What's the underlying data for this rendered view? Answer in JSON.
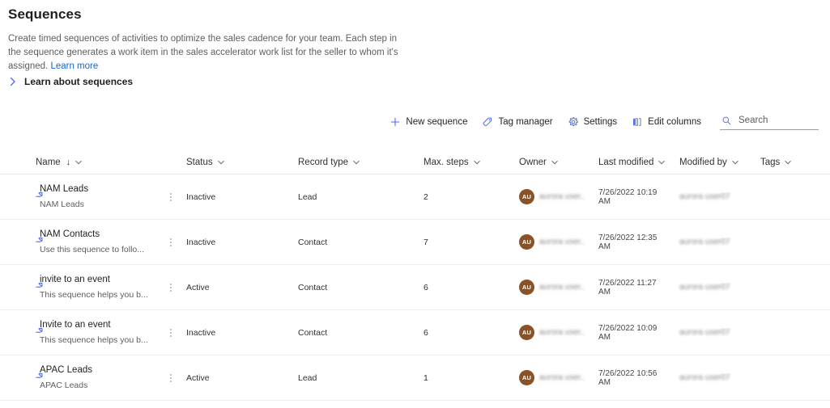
{
  "header": {
    "title": "Sequences",
    "description": "Create timed sequences of activities to optimize the sales cadence for your team. Each step in the sequence generates a work item in the sales accelerator work list for the seller to whom it's assigned.",
    "learn_more": "Learn more",
    "expander_label": "Learn about sequences"
  },
  "commandbar": {
    "new_sequence": "New sequence",
    "tag_manager": "Tag manager",
    "settings": "Settings",
    "edit_columns": "Edit columns",
    "search_placeholder": "Search",
    "search_value": ""
  },
  "grid": {
    "columns": [
      {
        "label": "Name",
        "sorted": true,
        "sort_glyph": "↓"
      },
      {
        "label": "Status"
      },
      {
        "label": "Record type"
      },
      {
        "label": "Max. steps"
      },
      {
        "label": "Owner"
      },
      {
        "label": "Last modified"
      },
      {
        "label": "Modified by"
      },
      {
        "label": "Tags"
      }
    ],
    "rows": [
      {
        "name": "NAM Leads",
        "subtitle": "NAM Leads",
        "status": "Inactive",
        "record_type": "Lead",
        "max_steps": "2",
        "owner_initials": "AU",
        "owner_name": "aurora user...",
        "last_modified": "7/26/2022 10:19 AM",
        "modified_by": "aurora user07",
        "tags": ""
      },
      {
        "name": "NAM Contacts",
        "subtitle": "Use this sequence to follo...",
        "status": "Inactive",
        "record_type": "Contact",
        "max_steps": "7",
        "owner_initials": "AU",
        "owner_name": "aurora user...",
        "last_modified": "7/26/2022 12:35 AM",
        "modified_by": "aurora user07",
        "tags": ""
      },
      {
        "name": "invite to an event",
        "subtitle": "This sequence helps you b...",
        "status": "Active",
        "record_type": "Contact",
        "max_steps": "6",
        "owner_initials": "AU",
        "owner_name": "aurora user...",
        "last_modified": "7/26/2022 11:27 AM",
        "modified_by": "aurora user07",
        "tags": ""
      },
      {
        "name": "Invite to an event",
        "subtitle": "This sequence helps you b...",
        "status": "Inactive",
        "record_type": "Contact",
        "max_steps": "6",
        "owner_initials": "AU",
        "owner_name": "aurora user...",
        "last_modified": "7/26/2022 10:09 AM",
        "modified_by": "aurora user07",
        "tags": ""
      },
      {
        "name": "APAC Leads",
        "subtitle": "APAC Leads",
        "status": "Active",
        "record_type": "Lead",
        "max_steps": "1",
        "owner_initials": "AU",
        "owner_name": "aurora user...",
        "last_modified": "7/26/2022 10:56 AM",
        "modified_by": "aurora user07",
        "tags": ""
      }
    ]
  },
  "colors": {
    "link": "#1268c3",
    "icon_accent": "#4f6bed",
    "avatar": "#8a5228",
    "text_primary": "#201f1e",
    "text_secondary": "#605e5c"
  }
}
